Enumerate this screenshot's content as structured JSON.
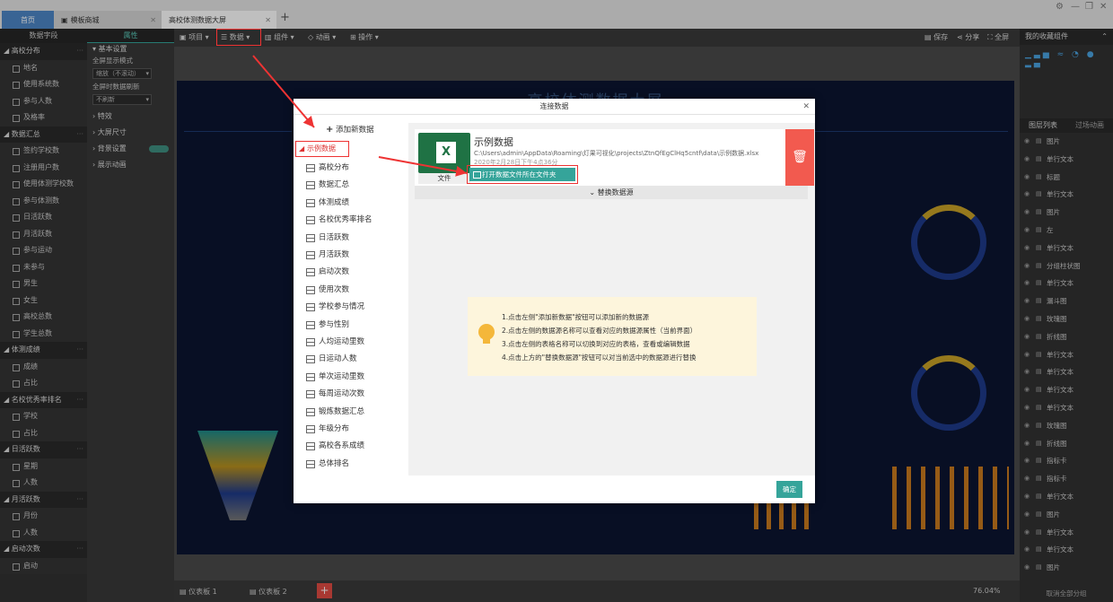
{
  "tabs": {
    "home": "首页",
    "market": "模板商城",
    "big_screen": "高校体测数据大屏"
  },
  "left_panel": {
    "tab_fields": "数据字段",
    "tab_props": "属性",
    "groups": [
      {
        "label": "高校分布",
        "items": [
          "地名",
          "使用系统数",
          "参与人数",
          "及格率"
        ]
      },
      {
        "label": "数据汇总",
        "items": [
          "签约学校数",
          "注册用户数",
          "使用体测学校数",
          "参与体测数",
          "日活跃数",
          "月活跃数",
          "参与运动",
          "未参与",
          "男生",
          "女生",
          "高校总数",
          "学生总数"
        ]
      },
      {
        "label": "体测成绩",
        "items": [
          "成绩",
          "占比"
        ]
      },
      {
        "label": "名校优秀率排名",
        "items": [
          "学校",
          "占比"
        ]
      },
      {
        "label": "日活跃数",
        "items": [
          "星期",
          "人数"
        ]
      },
      {
        "label": "月活跃数",
        "items": [
          "月份",
          "人数"
        ]
      },
      {
        "label": "启动次数",
        "items": [
          "启动"
        ]
      }
    ]
  },
  "props_panel": {
    "basic": "基本设置",
    "fullscreen_mode": "全屏显示模式",
    "fullscreen_value": "缩放（不滚动）",
    "refresh_label": "全屏时数据刷新",
    "refresh_value": "不刷新",
    "effects": "特效",
    "size": "大屏尺寸",
    "background": "背景设置",
    "animation": "展示动画"
  },
  "toolbar": {
    "project": "项目",
    "data": "数据",
    "component": "组件",
    "animation": "动画",
    "operate": "操作",
    "save": "保存",
    "share": "分享",
    "fullscreen": "全屏"
  },
  "canvas": {
    "title": "高校体测数据大屏",
    "zoom": "76.04%",
    "boards": [
      "仪表板 1",
      "仪表板 2"
    ]
  },
  "right_panel": {
    "favorites": "我的收藏组件",
    "tab_layers": "图层列表",
    "tab_transition": "过场动画",
    "layers": [
      "图片",
      "单行文本",
      "标题",
      "单行文本",
      "图片",
      "左",
      "单行文本",
      "分组柱状图",
      "单行文本",
      "漏斗图",
      "玫瑰图",
      "折线图",
      "单行文本",
      "单行文本",
      "单行文本",
      "单行文本",
      "玫瑰图",
      "折线图",
      "指标卡",
      "指标卡",
      "单行文本",
      "图片",
      "单行文本",
      "单行文本",
      "图片"
    ],
    "footer": "取消全部分组"
  },
  "modal": {
    "title": "连接数据",
    "add_new": "添加新数据",
    "source_group": "示例数据",
    "tables": [
      "高校分布",
      "数据汇总",
      "体测成绩",
      "名校优秀率排名",
      "日活跃数",
      "月活跃数",
      "启动次数",
      "使用次数",
      "学校参与情况",
      "参与性别",
      "人均运动里数",
      "日运动人数",
      "单次运动里数",
      "每周运动次数",
      "锻炼数据汇总",
      "年级分布",
      "高校各系成绩",
      "总体排名"
    ],
    "source_name": "示例数据",
    "source_path": "C:\\Users\\admin\\AppData\\Roaming\\灯果可视化\\projects\\ZtnQfEgClHq5cntf\\data\\示例数据.xlsx",
    "source_date": "2020年2月28日下午4点36分",
    "file_label": "文件",
    "open_folder": "打开数据文件所在文件夹",
    "replace_source": "替换数据源",
    "tips": [
      "1.点击左侧\"添加新数据\"按钮可以添加新的数据源",
      "2.点击左侧的数据源名称可以查看对应的数据源属性（当前界面）",
      "3.点击左侧的表格名称可以切换到对应的表格，查看或编辑数据",
      "4.点击上方的\"替换数据源\"按钮可以对当前选中的数据源进行替换"
    ],
    "ok": "确定"
  },
  "colors": {
    "accent": "#35a49a",
    "highlight": "#e33333",
    "delete": "#f25a4f",
    "screen_bg": "#0b1530"
  }
}
